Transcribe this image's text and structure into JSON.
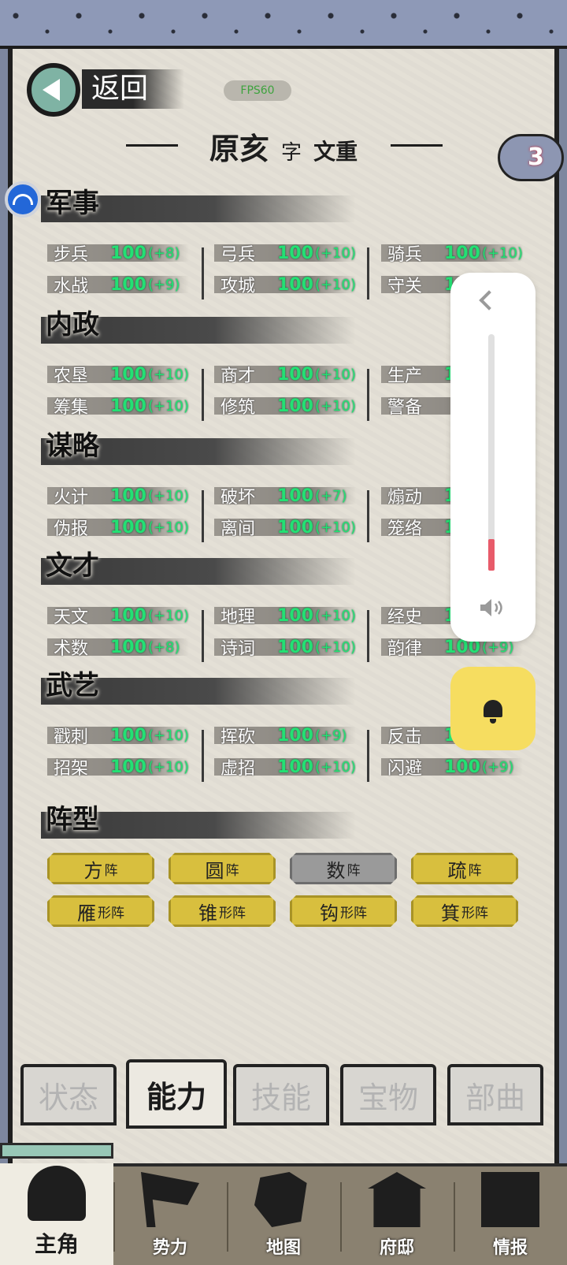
{
  "header": {
    "back_label": "返回",
    "fps": "FPS60",
    "name": "原亥",
    "zi": "字",
    "courtesy": "文重",
    "badge_count": "3"
  },
  "sections": [
    {
      "title": "军事",
      "stats": [
        {
          "name": "步兵",
          "value": "100",
          "bonus": "(+8)"
        },
        {
          "name": "弓兵",
          "value": "100",
          "bonus": "(+10)"
        },
        {
          "name": "骑兵",
          "value": "100",
          "bonus": "(+10)"
        },
        {
          "name": "水战",
          "value": "100",
          "bonus": "(+9)"
        },
        {
          "name": "攻城",
          "value": "100",
          "bonus": "(+10)"
        },
        {
          "name": "守关",
          "value": "1",
          "bonus": ""
        }
      ]
    },
    {
      "title": "内政",
      "stats": [
        {
          "name": "农垦",
          "value": "100",
          "bonus": "(+10)"
        },
        {
          "name": "商才",
          "value": "100",
          "bonus": "(+10)"
        },
        {
          "name": "生产",
          "value": "1",
          "bonus": ""
        },
        {
          "name": "筹集",
          "value": "100",
          "bonus": "(+10)"
        },
        {
          "name": "修筑",
          "value": "100",
          "bonus": "(+10)"
        },
        {
          "name": "警备",
          "value": "",
          "bonus": ""
        }
      ]
    },
    {
      "title": "谋略",
      "stats": [
        {
          "name": "火计",
          "value": "100",
          "bonus": "(+10)"
        },
        {
          "name": "破坏",
          "value": "100",
          "bonus": "(+7)"
        },
        {
          "name": "煽动",
          "value": "1",
          "bonus": ""
        },
        {
          "name": "伪报",
          "value": "100",
          "bonus": "(+10)"
        },
        {
          "name": "离间",
          "value": "100",
          "bonus": "(+10)"
        },
        {
          "name": "笼络",
          "value": "1",
          "bonus": ""
        }
      ]
    },
    {
      "title": "文才",
      "stats": [
        {
          "name": "天文",
          "value": "100",
          "bonus": "(+10)"
        },
        {
          "name": "地理",
          "value": "100",
          "bonus": "(+10)"
        },
        {
          "name": "经史",
          "value": "1",
          "bonus": ""
        },
        {
          "name": "术数",
          "value": "100",
          "bonus": "(+8)"
        },
        {
          "name": "诗词",
          "value": "100",
          "bonus": "(+10)"
        },
        {
          "name": "韵律",
          "value": "100",
          "bonus": "(+9)"
        }
      ]
    },
    {
      "title": "武艺",
      "stats": [
        {
          "name": "戳刺",
          "value": "100",
          "bonus": "(+10)"
        },
        {
          "name": "挥砍",
          "value": "100",
          "bonus": "(+9)"
        },
        {
          "name": "反击",
          "value": "1",
          "bonus": ""
        },
        {
          "name": "招架",
          "value": "100",
          "bonus": "(+10)"
        },
        {
          "name": "虚招",
          "value": "100",
          "bonus": "(+10)"
        },
        {
          "name": "闪避",
          "value": "100",
          "bonus": "(+9)"
        }
      ]
    }
  ],
  "formation_title": "阵型",
  "formations": [
    {
      "main": "方",
      "sub": "阵"
    },
    {
      "main": "圆",
      "sub": "阵"
    },
    {
      "main": "数",
      "sub": "阵"
    },
    {
      "main": "疏",
      "sub": "阵"
    },
    {
      "main": "雁",
      "sub": "形阵"
    },
    {
      "main": "锥",
      "sub": "形阵"
    },
    {
      "main": "钩",
      "sub": "形阵"
    },
    {
      "main": "箕",
      "sub": "形阵"
    }
  ],
  "tabs": [
    "状态",
    "能力",
    "技能",
    "宝物",
    "部曲"
  ],
  "nav": [
    "主角",
    "势力",
    "地图",
    "府邸",
    "情报"
  ],
  "colors": {
    "stat_value": "#23e074",
    "formation_gold": "#d8bf3e",
    "formation_gray": "#9a9a9a",
    "bell_button": "#f6dd60",
    "volume_fill": "#e85b6a"
  }
}
